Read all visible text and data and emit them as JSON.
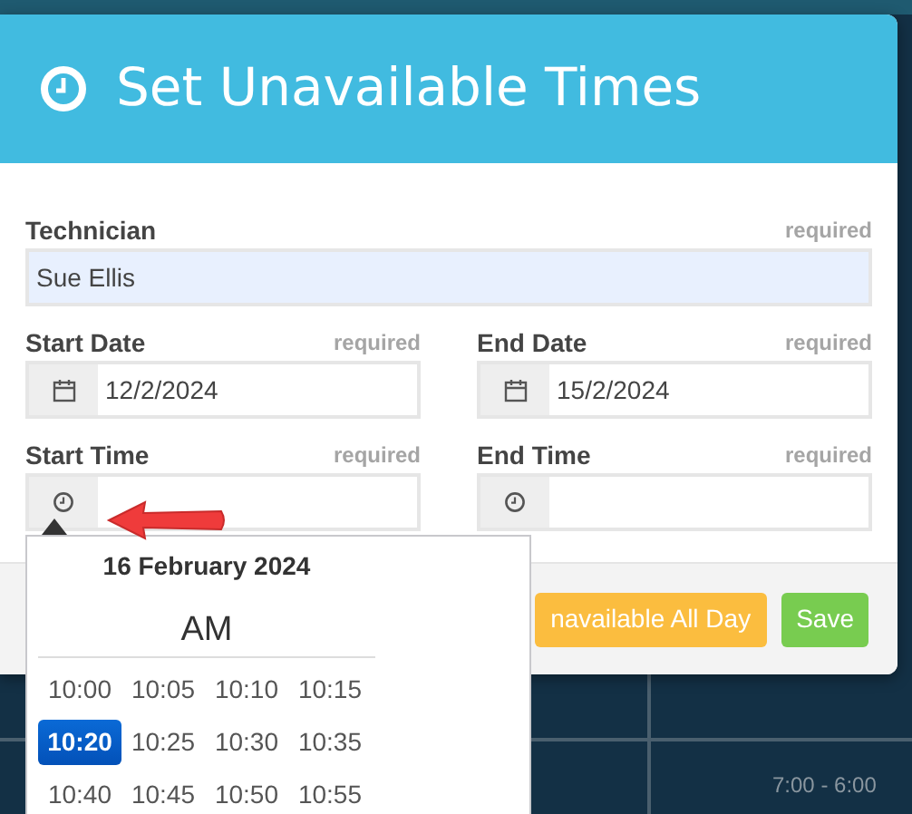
{
  "dialog": {
    "title": "Set Unavailable Times",
    "fields": [
      {
        "kind": "text",
        "label": "Technician",
        "required": "required",
        "value": "Sue Ellis"
      },
      {
        "kind": "date",
        "label": "Start Date",
        "required": "required",
        "value": "12/2/2024"
      },
      {
        "kind": "date",
        "label": "End Date",
        "required": "required",
        "value": "15/2/2024"
      },
      {
        "kind": "time",
        "label": "Start Time",
        "required": "required"
      },
      {
        "kind": "time",
        "label": "End Time",
        "required": "required"
      }
    ],
    "buttons": [
      {
        "kind": "warning",
        "label": "navailable All Day"
      },
      {
        "kind": "success",
        "label": "Save"
      }
    ]
  },
  "time_picker": {
    "date": "16 February 2024",
    "period": "AM",
    "times": [
      {
        "label": "10:00",
        "selected": false
      },
      {
        "label": "10:05",
        "selected": false
      },
      {
        "label": "10:10",
        "selected": false
      },
      {
        "label": "10:15",
        "selected": false
      },
      {
        "label": "10:20",
        "selected": true
      },
      {
        "label": "10:25",
        "selected": false
      },
      {
        "label": "10:30",
        "selected": false
      },
      {
        "label": "10:35",
        "selected": false
      },
      {
        "label": "10:40",
        "selected": false
      },
      {
        "label": "10:45",
        "selected": false
      },
      {
        "label": "10:50",
        "selected": false
      },
      {
        "label": "10:55",
        "selected": false
      }
    ]
  },
  "schedule": {
    "slots": [
      "7:00 - 6:00"
    ]
  }
}
